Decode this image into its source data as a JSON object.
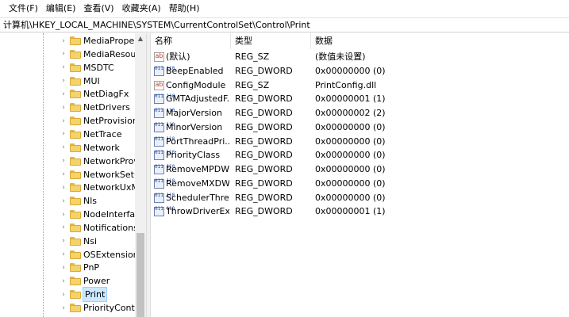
{
  "menubar": {
    "items": [
      "文件(F)",
      "编辑(E)",
      "查看(V)",
      "收藏夹(A)",
      "帮助(H)"
    ]
  },
  "address": {
    "path": "计算机\\HKEY_LOCAL_MACHINE\\SYSTEM\\CurrentControlSet\\Control\\Print"
  },
  "tree": {
    "items": [
      {
        "label": "MediaProper"
      },
      {
        "label": "MediaResour"
      },
      {
        "label": "MSDTC"
      },
      {
        "label": "MUI"
      },
      {
        "label": "NetDiagFx"
      },
      {
        "label": "NetDrivers"
      },
      {
        "label": "NetProvision"
      },
      {
        "label": "NetTrace"
      },
      {
        "label": "Network"
      },
      {
        "label": "NetworkProv"
      },
      {
        "label": "NetworkSetu"
      },
      {
        "label": "NetworkUxM"
      },
      {
        "label": "Nls"
      },
      {
        "label": "NodeInterfac"
      },
      {
        "label": "Notifications"
      },
      {
        "label": "Nsi"
      },
      {
        "label": "OSExtensionI"
      },
      {
        "label": "PnP"
      },
      {
        "label": "Power"
      },
      {
        "label": "Print",
        "selected": true
      },
      {
        "label": "PriorityContro"
      }
    ]
  },
  "columns": {
    "name": "名称",
    "type": "类型",
    "data": "数据"
  },
  "values": [
    {
      "icon": "string-value-icon",
      "name": "(默认)",
      "type": "REG_SZ",
      "data": "(数值未设置)"
    },
    {
      "icon": "dword-value-icon",
      "name": "BeepEnabled",
      "type": "REG_DWORD",
      "data": "0x00000000 (0)"
    },
    {
      "icon": "string-value-icon",
      "name": "ConfigModule",
      "type": "REG_SZ",
      "data": "PrintConfig.dll"
    },
    {
      "icon": "dword-value-icon",
      "name": "GMTAdjustedF...",
      "type": "REG_DWORD",
      "data": "0x00000001 (1)"
    },
    {
      "icon": "dword-value-icon",
      "name": "MajorVersion",
      "type": "REG_DWORD",
      "data": "0x00000002 (2)"
    },
    {
      "icon": "dword-value-icon",
      "name": "MinorVersion",
      "type": "REG_DWORD",
      "data": "0x00000000 (0)"
    },
    {
      "icon": "dword-value-icon",
      "name": "PortThreadPri...",
      "type": "REG_DWORD",
      "data": "0x00000000 (0)"
    },
    {
      "icon": "dword-value-icon",
      "name": "PriorityClass",
      "type": "REG_DWORD",
      "data": "0x00000000 (0)"
    },
    {
      "icon": "dword-value-icon",
      "name": "RemoveMPDW",
      "type": "REG_DWORD",
      "data": "0x00000000 (0)"
    },
    {
      "icon": "dword-value-icon",
      "name": "RemoveMXDW",
      "type": "REG_DWORD",
      "data": "0x00000000 (0)"
    },
    {
      "icon": "dword-value-icon",
      "name": "SchedulerThre...",
      "type": "REG_DWORD",
      "data": "0x00000000 (0)"
    },
    {
      "icon": "dword-value-icon",
      "name": "ThrowDriverEx...",
      "type": "REG_DWORD",
      "data": "0x00000001 (1)"
    }
  ],
  "icons": {
    "string_glyph": "ab",
    "dword_glyph": "011 110"
  },
  "colors": {
    "selection": "#cce8ff",
    "folder": "#f5d36b"
  }
}
